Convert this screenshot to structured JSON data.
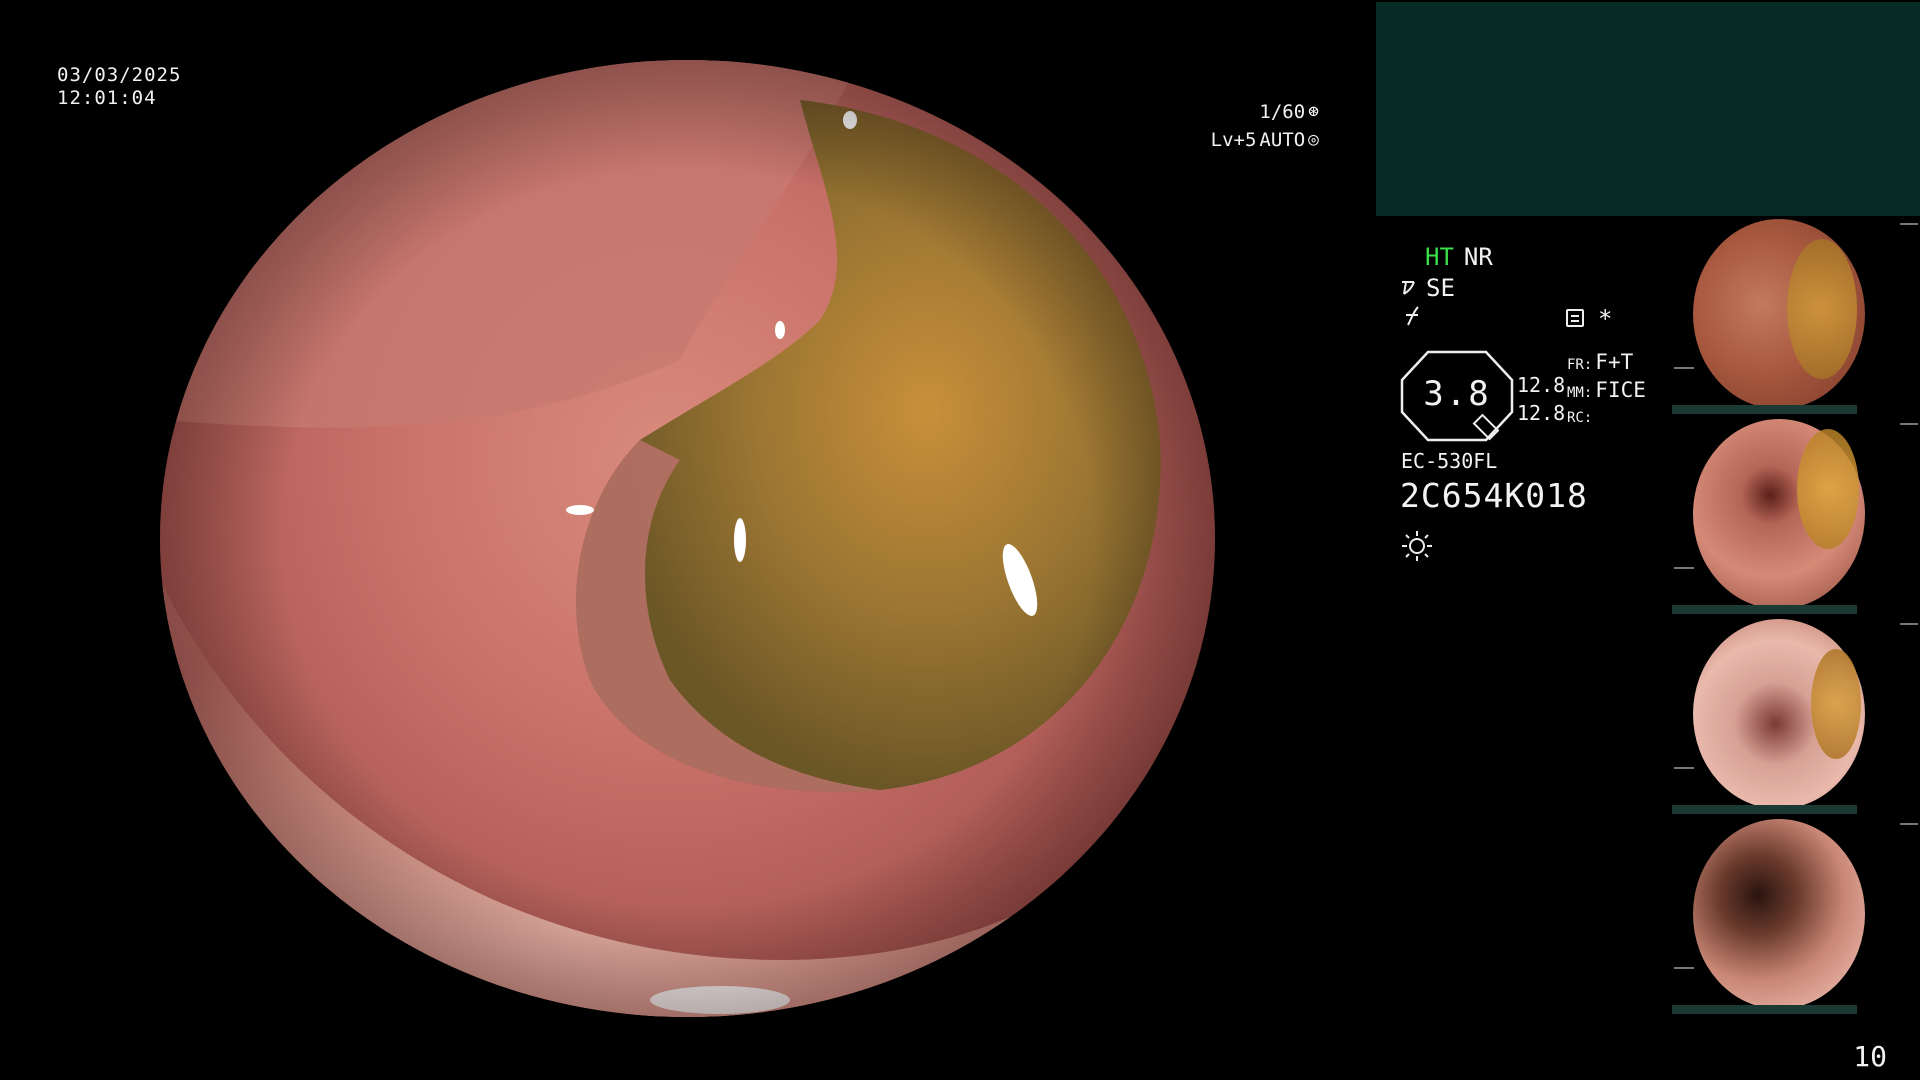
{
  "overlay": {
    "date": "03/03/2025",
    "time": "12:01:04",
    "shutter": "1/60",
    "shutter_icon": "aperture-icon",
    "brightness": "Lv+5",
    "iris_mode": "AUTO",
    "iris_icon": "iris-icon"
  },
  "panel": {
    "mode_primary": "HT",
    "mode_secondary": "NR",
    "mode_primary_color": "#39e04a",
    "se_label": "SE",
    "zoom_value": "3.8",
    "value_a": "12.8",
    "value_b": "12.8",
    "params": [
      {
        "key": "FR:",
        "value": "F+T"
      },
      {
        "key": "MM:",
        "value": "FICE"
      },
      {
        "key": "RC:",
        "value": ""
      }
    ],
    "scope_model": "EC-530FL",
    "scope_serial": "2C654K018",
    "light_icon": "light-source-icon",
    "teal_box_color": "#052b24"
  },
  "thumbnails": [
    {
      "label": "thumbnail-1"
    },
    {
      "label": "thumbnail-2"
    },
    {
      "label": "thumbnail-3"
    },
    {
      "label": "thumbnail-4"
    }
  ],
  "page_number": "10"
}
